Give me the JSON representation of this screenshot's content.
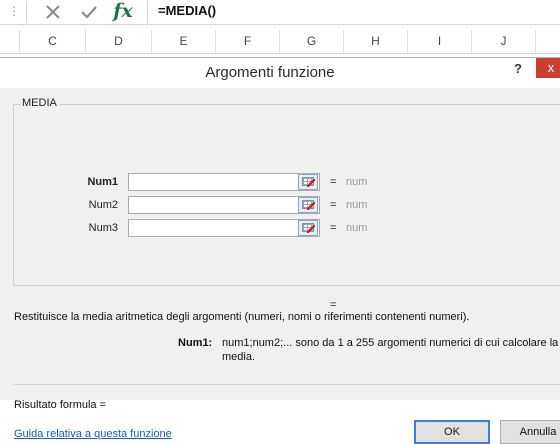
{
  "formula_bar": {
    "grip": "⋮",
    "cancel_icon": "close-x",
    "enter_icon": "check",
    "fx_label": "fx",
    "formula": "=MEDIA()"
  },
  "columns": [
    "C",
    "D",
    "E",
    "F",
    "G",
    "H",
    "I",
    "J"
  ],
  "dialog": {
    "title": "Argomenti funzione",
    "help": "?",
    "close": "x",
    "function_name": "MEDIA",
    "arguments": [
      {
        "label": "Num1",
        "value": "",
        "result": "num",
        "active": true
      },
      {
        "label": "Num2",
        "value": "",
        "result": "num",
        "active": false
      },
      {
        "label": "Num3",
        "value": "",
        "result": "num",
        "active": false
      }
    ],
    "equals": "=",
    "description": "Restituisce la media aritmetica degli argomenti (numeri, nomi o riferimenti contenenti numeri).",
    "arg_help_name": "Num1:",
    "arg_help_text": "num1;num2;... sono da 1 a 255 argomenti numerici di cui calcolare la media.",
    "formula_result": "Risultato formula =",
    "help_link": "Guida relativa a questa funzione",
    "ok": "OK",
    "cancel": "Annulla"
  },
  "colors": {
    "accent_green": "#217346",
    "close_red": "#c84031",
    "link_blue": "#1a57c9",
    "dialog_bg": "#f0f0f0"
  }
}
